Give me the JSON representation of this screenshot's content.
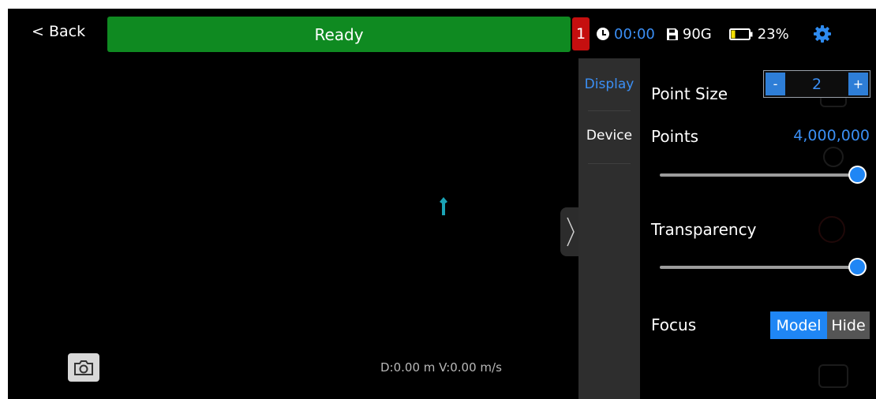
{
  "topbar": {
    "back_label": "< Back",
    "status": "Ready",
    "badge_count": "1",
    "time": "00:00",
    "storage": "90G",
    "battery": "23%",
    "battery_level": 0.23
  },
  "viewport": {
    "readout": "D:0.00 m V:0.00 m/s"
  },
  "tabs": [
    {
      "label": "Display",
      "active": true
    },
    {
      "label": "Device",
      "active": false
    }
  ],
  "display_settings": {
    "point_size_label": "Point Size",
    "point_size_value": "2",
    "minus": "-",
    "plus": "+",
    "points_label": "Points",
    "points_value": "4,000,000",
    "points_slider_level": 1.0,
    "transparency_label": "Transparency",
    "transparency_slider_level": 1.0,
    "focus_label": "Focus",
    "focus_options": [
      "Model",
      "Hide"
    ],
    "focus_selected": "Model"
  },
  "icons": [
    "clock-icon",
    "save-icon",
    "battery-icon",
    "gear-icon",
    "camera-icon",
    "chevron-right-icon",
    "marker-icon"
  ],
  "colors": {
    "status_green": "#0f8a21",
    "badge_red": "#c50f0f",
    "accent_blue": "#3b8ff5",
    "toggle_blue": "#1f86f5"
  }
}
